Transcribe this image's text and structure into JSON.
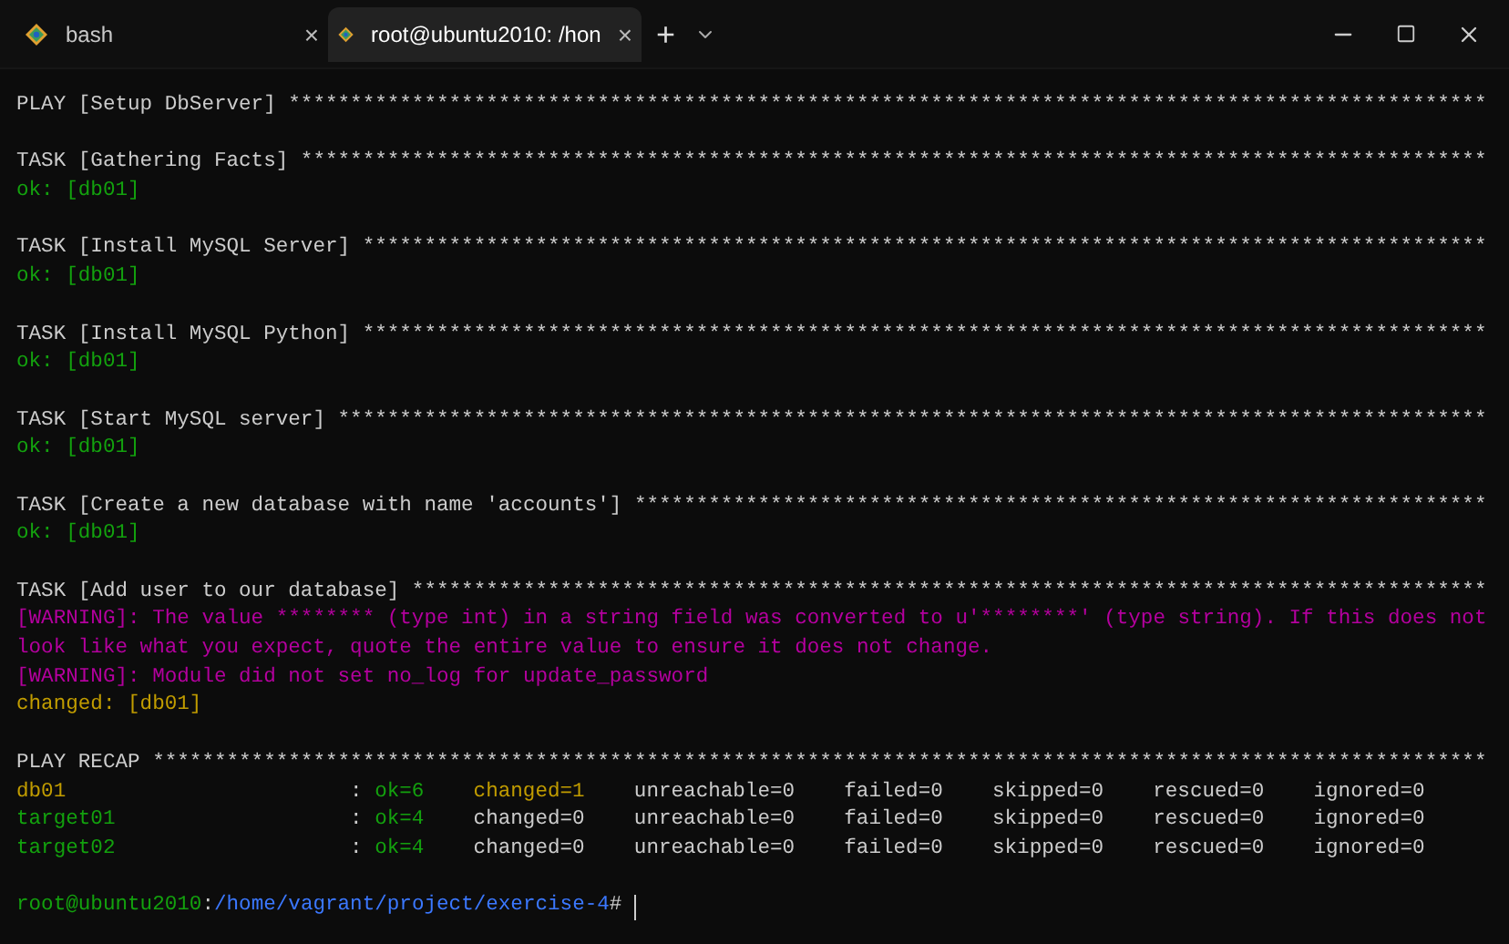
{
  "tabs": [
    {
      "title": "bash",
      "close": "×",
      "selected": false
    },
    {
      "title": "root@ubuntu2010: /hon",
      "close": "×",
      "selected": true
    }
  ],
  "new_tab": "+",
  "output": [
    {
      "lines": [
        [
          {
            "text": "PLAY [Setup DbServer] *************************************************************************************************",
            "color": "#cccccc"
          }
        ]
      ]
    },
    {
      "lines": [
        [
          {
            "text": "TASK [Gathering Facts] ************************************************************************************************",
            "color": "#cccccc"
          }
        ],
        [
          {
            "text": "ok: [db01]",
            "color": "#13a10e"
          }
        ]
      ]
    },
    {
      "lines": [
        [
          {
            "text": "TASK [Install MySQL Server] *******************************************************************************************",
            "color": "#cccccc"
          }
        ],
        [
          {
            "text": "ok: [db01]",
            "color": "#13a10e"
          }
        ]
      ]
    },
    {
      "lines": [
        [
          {
            "text": "TASK [Install MySQL Python] *******************************************************************************************",
            "color": "#cccccc"
          }
        ],
        [
          {
            "text": "ok: [db01]",
            "color": "#13a10e"
          }
        ]
      ]
    },
    {
      "lines": [
        [
          {
            "text": "TASK [Start MySQL server] *********************************************************************************************",
            "color": "#cccccc"
          }
        ],
        [
          {
            "text": "ok: [db01]",
            "color": "#13a10e"
          }
        ]
      ]
    },
    {
      "lines": [
        [
          {
            "text": "TASK [Create a new database with name 'accounts'] *********************************************************************",
            "color": "#cccccc"
          }
        ],
        [
          {
            "text": "ok: [db01]",
            "color": "#13a10e"
          }
        ]
      ]
    },
    {
      "lines": [
        [
          {
            "text": "TASK [Add user to our database] ***************************************************************************************",
            "color": "#cccccc"
          }
        ],
        [
          {
            "text": "[WARNING]: The value ******** (type int) in a string field was converted to u'********' (type string). If this does not",
            "color": "#b4009e"
          }
        ],
        [
          {
            "text": "look like what you expect, quote the entire value to ensure it does not change.",
            "color": "#b4009e"
          }
        ],
        [
          {
            "text": "[WARNING]: Module did not set no_log for update_password",
            "color": "#b4009e"
          }
        ],
        [
          {
            "text": "changed: [db01]",
            "color": "#c19c00"
          }
        ]
      ]
    }
  ],
  "recap": {
    "title": "PLAY RECAP ************************************************************************************************************",
    "rows": [
      [
        {
          "text": "db01",
          "color": "#c19c00"
        },
        {
          "text": ":",
          "color": "#cccccc"
        },
        {
          "text": "ok=6",
          "color": "#13a10e"
        },
        {
          "text": "changed=1",
          "color": "#c19c00"
        },
        {
          "text": "unreachable=0",
          "color": "#cccccc"
        },
        {
          "text": "failed=0",
          "color": "#cccccc"
        },
        {
          "text": "skipped=0",
          "color": "#cccccc"
        },
        {
          "text": "rescued=0",
          "color": "#cccccc"
        },
        {
          "text": "ignored=0",
          "color": "#cccccc"
        }
      ],
      [
        {
          "text": "target01",
          "color": "#13a10e"
        },
        {
          "text": ":",
          "color": "#cccccc"
        },
        {
          "text": "ok=4",
          "color": "#13a10e"
        },
        {
          "text": "changed=0",
          "color": "#cccccc"
        },
        {
          "text": "unreachable=0",
          "color": "#cccccc"
        },
        {
          "text": "failed=0",
          "color": "#cccccc"
        },
        {
          "text": "skipped=0",
          "color": "#cccccc"
        },
        {
          "text": "rescued=0",
          "color": "#cccccc"
        },
        {
          "text": "ignored=0",
          "color": "#cccccc"
        }
      ],
      [
        {
          "text": "target02",
          "color": "#13a10e"
        },
        {
          "text": ":",
          "color": "#cccccc"
        },
        {
          "text": "ok=4",
          "color": "#13a10e"
        },
        {
          "text": "changed=0",
          "color": "#cccccc"
        },
        {
          "text": "unreachable=0",
          "color": "#cccccc"
        },
        {
          "text": "failed=0",
          "color": "#cccccc"
        },
        {
          "text": "skipped=0",
          "color": "#cccccc"
        },
        {
          "text": "rescued=0",
          "color": "#cccccc"
        },
        {
          "text": "ignored=0",
          "color": "#cccccc"
        }
      ]
    ]
  },
  "prompt": [
    {
      "text": "root@ubuntu2010",
      "color": "#13a10e"
    },
    {
      "text": ":",
      "color": "#cccccc"
    },
    {
      "text": "/home/vagrant/project/exercise-4",
      "color": "#3b78ff"
    },
    {
      "text": "#",
      "color": "#cccccc"
    }
  ]
}
